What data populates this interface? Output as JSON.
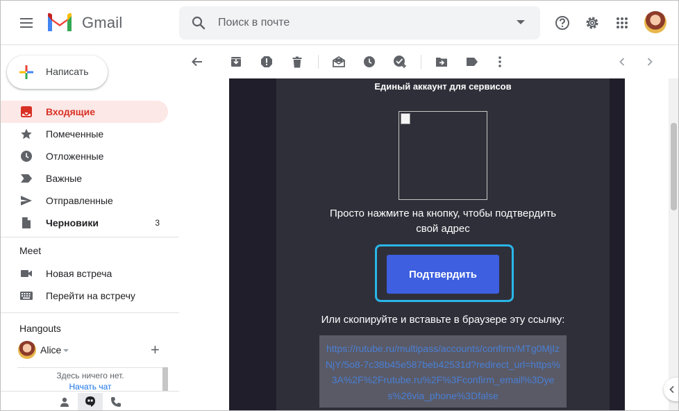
{
  "app": {
    "logo_text": "Gmail"
  },
  "search": {
    "placeholder": "Поиск в почте"
  },
  "compose": {
    "label": "Написать"
  },
  "sidebar": {
    "items": [
      {
        "label": "Входящие",
        "icon": "inbox-icon",
        "active": true
      },
      {
        "label": "Помеченные",
        "icon": "star-icon"
      },
      {
        "label": "Отложенные",
        "icon": "clock-icon"
      },
      {
        "label": "Важные",
        "icon": "important-icon"
      },
      {
        "label": "Отправленные",
        "icon": "send-icon"
      },
      {
        "label": "Черновики",
        "icon": "draft-icon",
        "count": "3",
        "bold": true
      }
    ],
    "meet": {
      "title": "Meet",
      "items": [
        {
          "label": "Новая встреча",
          "icon": "video-icon"
        },
        {
          "label": "Перейти на встречу",
          "icon": "keyboard-icon"
        }
      ]
    },
    "hangouts": {
      "title": "Hangouts",
      "user": "Alice",
      "empty_text": "Здесь ничего нет.",
      "start_chat": "Начать чат"
    }
  },
  "email": {
    "title": "Единый аккаунт для сервисов",
    "instruction": "Просто нажмите на кнопку, чтобы подтвердить свой адрес",
    "confirm_button": "Подтвердить",
    "copy_instruction": "Или скопируйте и вставьте в браузере эту ссылку:",
    "link": "https://rutube.ru/multipass/accounts/confirm/MTg0MjIzNjY/5o8-7c38b45e587beb42531d?redirect_url=https%3A%2F%2Frutube.ru%2F%3Fconfirm_email%3Dyes%26via_phone%3Dfalse"
  },
  "colors": {
    "accent_red": "#d93025",
    "confirm_button": "#3d5fe0",
    "highlight_frame": "#29b6e8",
    "mail_background": "#2f2f3a",
    "link_color": "#4a7fd4"
  }
}
